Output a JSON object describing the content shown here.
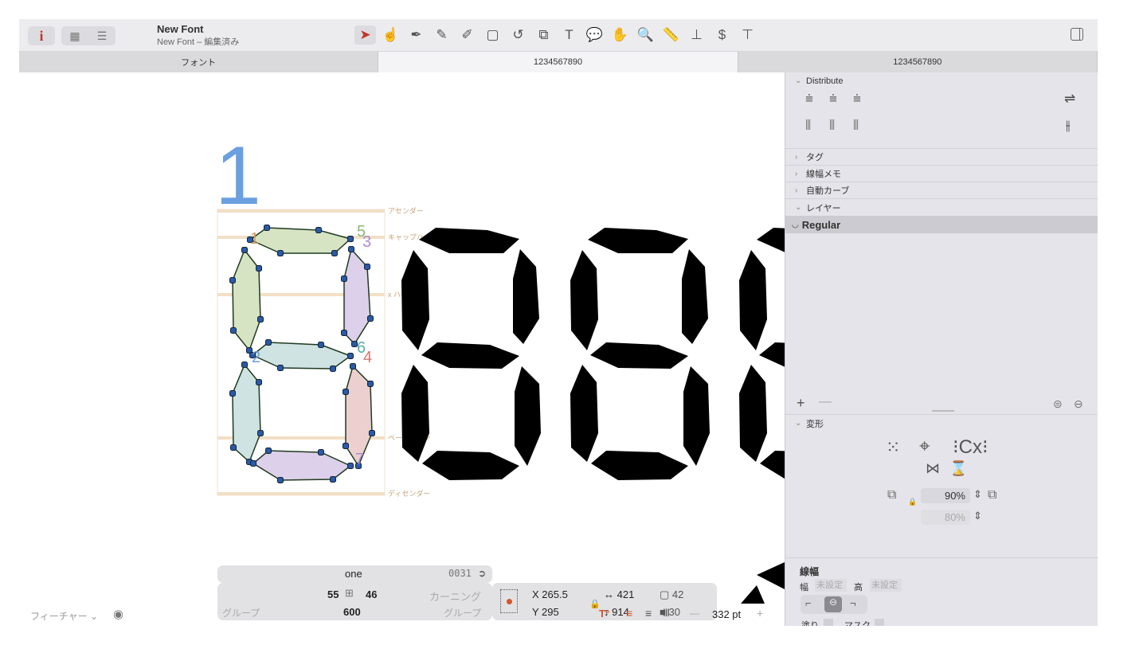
{
  "toolbar": {
    "info_icon": "i",
    "title": "New Font",
    "subtitle": "New Font – 編集済み",
    "tools": [
      "select-arrow",
      "hand-draw",
      "pen",
      "brush",
      "pencil",
      "rectangle",
      "rotate",
      "scale",
      "text",
      "annotation",
      "hand",
      "zoom",
      "measure",
      "component",
      "sample-text",
      "type-cursor"
    ],
    "tool_glyphs": [
      "➤",
      "☝",
      "✒",
      "✎",
      "✐",
      "▢",
      "↺",
      "⧉",
      "T",
      "💬",
      "✋",
      "🔍",
      "📏",
      "⊥",
      "$",
      "⊤"
    ]
  },
  "tabs": [
    {
      "label": "フォント"
    },
    {
      "label": "1234567890",
      "active": true
    },
    {
      "label": "1234567890"
    }
  ],
  "canvas": {
    "glyph_preview_char": "1",
    "metrics": [
      "アセンダー",
      "キャップハイト",
      "x ハイト",
      "ベースライン",
      "ディセンダー"
    ],
    "node_numbers": [
      "1",
      "5",
      "3",
      "2",
      "6",
      "4",
      "7"
    ],
    "accent_color": "#6a9fe0"
  },
  "infobox": {
    "glyph_name": "one",
    "unicode": "0031",
    "lsb": "55",
    "rsb": "46",
    "width": "600",
    "kerning_label": "カーニング",
    "group_left": "グループ",
    "group_right": "グループ",
    "x": "X 265.5",
    "y": "Y 295",
    "w": "421",
    "h": "914",
    "corner1": "42",
    "corner2": "30"
  },
  "bottom": {
    "features": "フィーチャー",
    "size": "332 pt",
    "minus": "—",
    "plus": "+"
  },
  "panel": {
    "distribute": "Distribute",
    "sections": [
      "タグ",
      "線幅メモ",
      "自動カーブ",
      "レイヤー"
    ],
    "layer": "Regular",
    "transform": "変形",
    "scale1": "90%",
    "scale2": "80%",
    "stroke_title": "線幅",
    "stroke_w_label": "幅",
    "stroke_w": "未設定",
    "stroke_h_label": "高",
    "stroke_h": "未設定",
    "fill_label": "塗り",
    "mask_label": "マスク"
  }
}
